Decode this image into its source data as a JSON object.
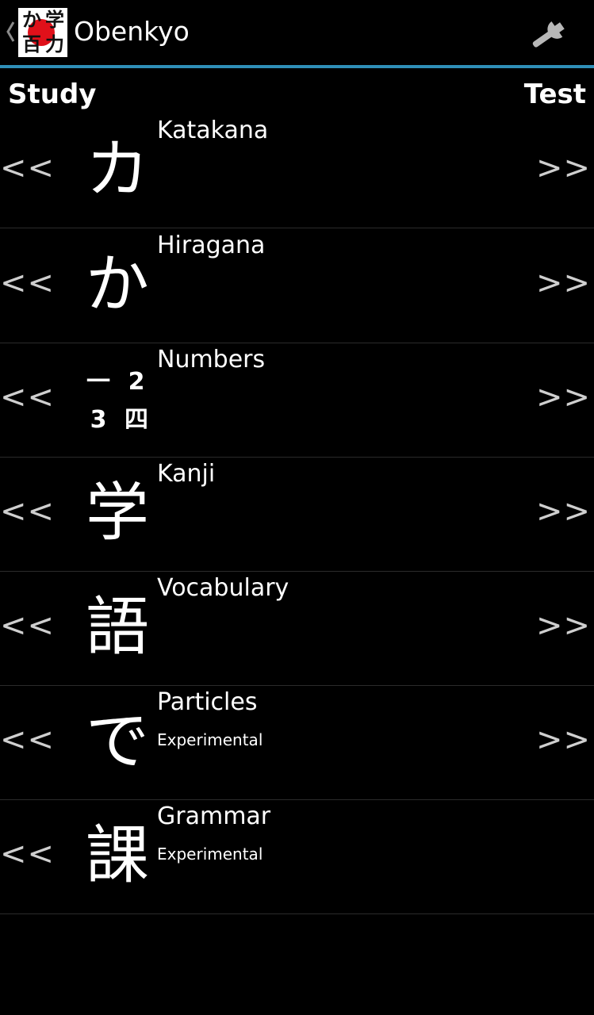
{
  "app": {
    "title": "Obenkyo",
    "icon_glyphs": [
      "か",
      "学",
      "百",
      "力"
    ],
    "accent_color": "#2f8fb8"
  },
  "header": {
    "study_label": "Study",
    "test_label": "Test"
  },
  "arrows": {
    "study": "<<",
    "test": ">>"
  },
  "items": [
    {
      "name": "Katakana",
      "subtitle": "",
      "glyph": "カ",
      "has_test": true
    },
    {
      "name": "Hiragana",
      "subtitle": "",
      "glyph": "か",
      "has_test": true
    },
    {
      "name": "Numbers",
      "subtitle": "",
      "glyph_grid": [
        "一",
        "2",
        "3",
        "四"
      ],
      "has_test": true
    },
    {
      "name": "Kanji",
      "subtitle": "",
      "glyph": "学",
      "has_test": true
    },
    {
      "name": "Vocabulary",
      "subtitle": "",
      "glyph": "語",
      "has_test": true
    },
    {
      "name": "Particles",
      "subtitle": "Experimental",
      "glyph": "で",
      "has_test": true
    },
    {
      "name": "Grammar",
      "subtitle": "Experimental",
      "glyph": "課",
      "has_test": false
    }
  ],
  "icons": {
    "up": "chevron-left-icon",
    "settings": "wrench-icon"
  }
}
